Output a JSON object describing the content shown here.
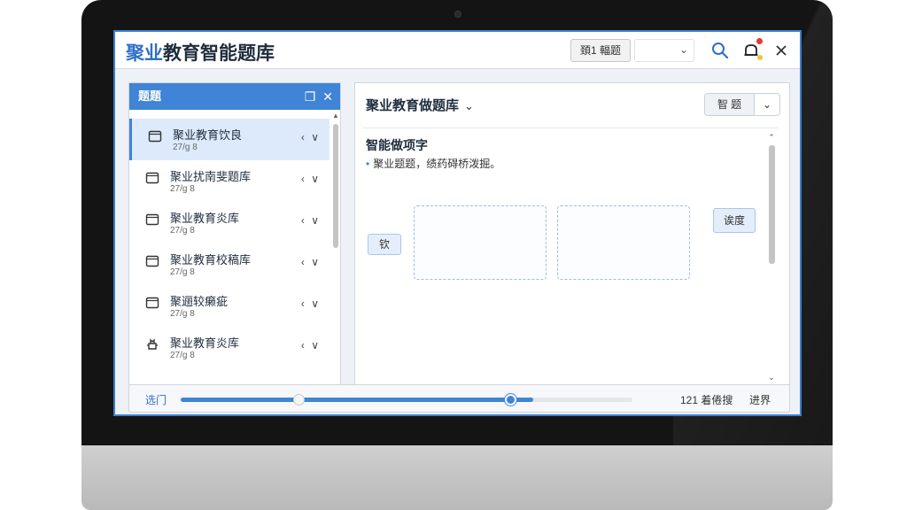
{
  "app": {
    "title_accent": "聚业",
    "title_rest": "教育智能题库"
  },
  "titlebar": {
    "select_label": "頚1 輻题",
    "dropdown_value": ""
  },
  "sidebar": {
    "title": "题题",
    "items": [
      {
        "name": "聚业教育饮良",
        "meta": "27/g 8",
        "icon": "folder-icon"
      },
      {
        "name": "聚业扰南斐题库",
        "meta": "27/g 8",
        "icon": "folder-icon"
      },
      {
        "name": "聚业教育炎库",
        "meta": "27/g 8",
        "icon": "folder-icon"
      },
      {
        "name": "聚业教育校稿库",
        "meta": "27/g 8",
        "icon": "folder-icon"
      },
      {
        "name": "聚逦较癞疵",
        "meta": "27/g 8",
        "icon": "folder-icon"
      },
      {
        "name": "聚业教育炎库",
        "meta": "27/g 8",
        "icon": "robot-icon"
      }
    ],
    "arrows": "‹ ∨"
  },
  "main": {
    "title": "聚业教育做题库",
    "seg_a": "智 题",
    "heading": "智能做项字",
    "bullet": "聚业题题，绩药碍桥泼掘。",
    "left_button": "钦",
    "right_button": "诶度"
  },
  "bottom": {
    "label": "选门",
    "count": "121 着倦搜",
    "right": "进界",
    "progress_fill": 0.78,
    "knob_a": 0.26,
    "knob_b": 0.73
  },
  "colors": {
    "accent": "#3f84d6",
    "title_blue": "#2f6fc7",
    "alert": "#e53935"
  }
}
